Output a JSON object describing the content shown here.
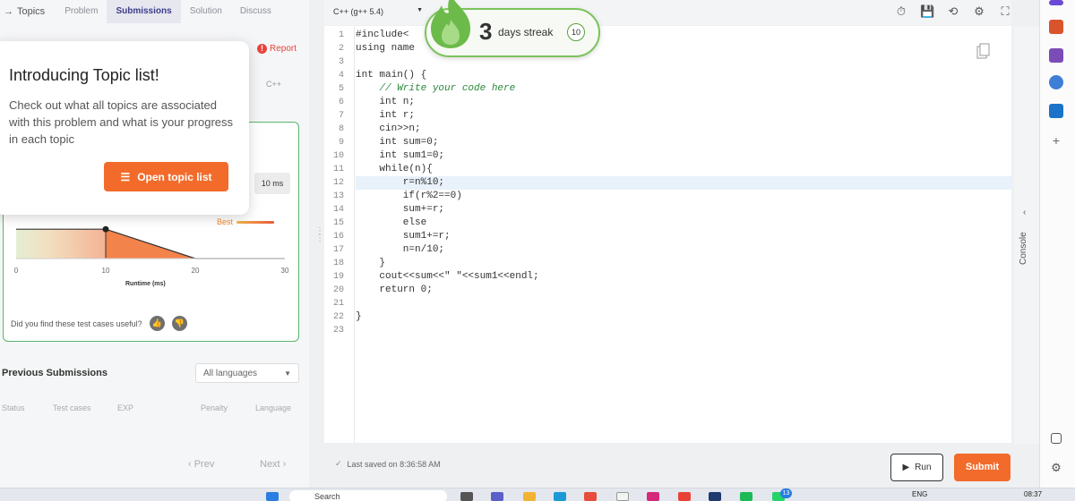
{
  "tabs": {
    "topics": "Topics",
    "problem": "Problem",
    "submissions": "Submissions",
    "solution": "Solution",
    "discuss": "Discuss"
  },
  "report": "Report",
  "language_small": "C++",
  "runtime_value": "10 ms",
  "best_label": "Best",
  "chart_data": {
    "type": "area",
    "x": [
      0,
      10,
      20,
      30
    ],
    "y": [
      0.5,
      0.5,
      0.0,
      0.0
    ],
    "marker_x": 10,
    "xlabel": "Runtime (ms)",
    "tick_labels": [
      "0",
      "10",
      "20",
      "30"
    ],
    "xlim": [
      0,
      30
    ]
  },
  "feedback_question": "Did you find these test cases useful?",
  "popover": {
    "title": "Introducing Topic list!",
    "body": "Check out what all topics are associated with this problem and what is your progress in each topic",
    "button": "Open topic list"
  },
  "previous_submissions": {
    "title": "Previous Submissions",
    "filter": "All languages",
    "columns": [
      "Status",
      "Test cases",
      "EXP",
      "Penalty",
      "Language"
    ]
  },
  "pager": {
    "prev": "‹ Prev",
    "next": "Next ›"
  },
  "editor": {
    "language": "C++ (g++ 5.4)",
    "code_lines": [
      "#include<",
      "using name",
      "",
      "int main() {",
      "    // Write your code here",
      "    int n;",
      "    int r;",
      "    cin>>n;",
      "    int sum=0;",
      "    int sum1=0;",
      "    while(n){",
      "        r=n%10;",
      "        if(r%2==0)",
      "        sum+=r;",
      "        else",
      "        sum1+=r;",
      "        n=n/10;",
      "    }",
      "    cout<<sum<<\" \"<<sum1<<endl;",
      "    return 0;",
      "",
      "}",
      ""
    ],
    "highlight_line": 12
  },
  "streak": {
    "number": "3",
    "label": "days streak",
    "count": "10"
  },
  "console_label": "Console",
  "last_saved": "Last saved on 8:36:58 AM",
  "run_label": "Run",
  "submit_label": "Submit",
  "taskbar": {
    "search": "Search",
    "lang": "ENG",
    "time": "08:37",
    "badge": "13"
  },
  "colors": {
    "accent": "#f26b2b",
    "success": "#5ab56a",
    "streak_green": "#7cc35d"
  }
}
